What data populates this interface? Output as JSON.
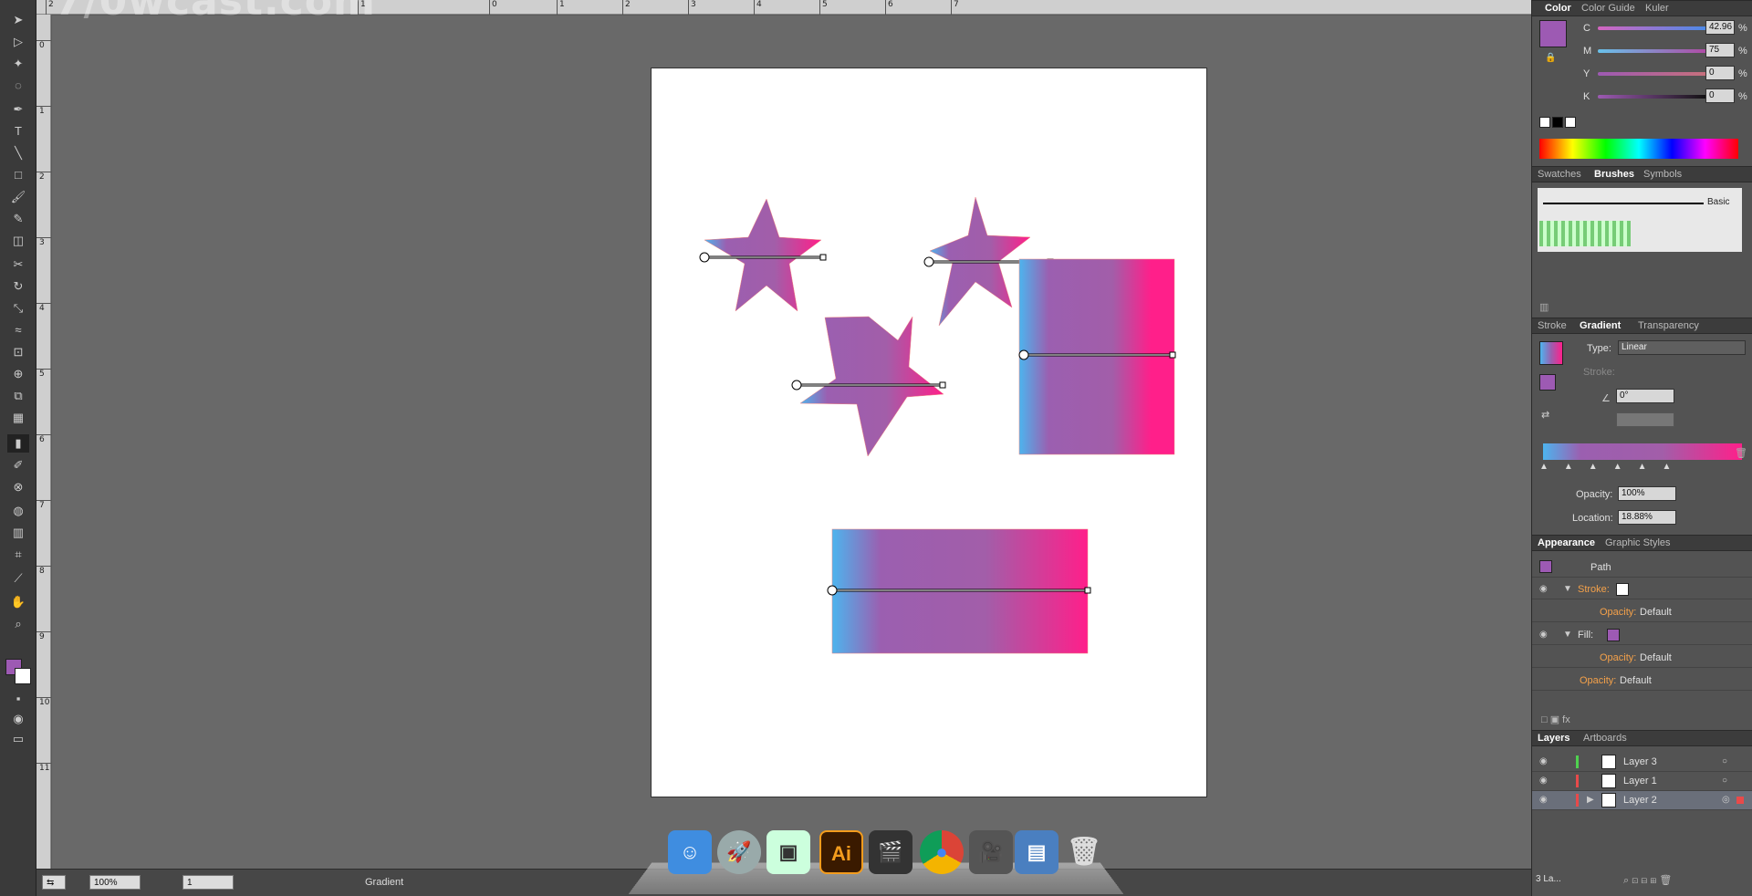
{
  "watermark": "7/0wcast.com",
  "ruler": {
    "top_ticks": [
      "2",
      "1",
      "0",
      "1",
      "2",
      "3",
      "4",
      "5",
      "6",
      "7"
    ],
    "left_ticks": [
      "0",
      "1",
      "2",
      "3",
      "4",
      "5",
      "6",
      "7",
      "8",
      "9",
      "10",
      "11"
    ]
  },
  "color_panel": {
    "tabs": [
      "Color",
      "Color Guide",
      "Kuler"
    ],
    "channels": [
      {
        "label": "C",
        "value": "42.96",
        "unit": "%",
        "level": 0.43
      },
      {
        "label": "M",
        "value": "75",
        "unit": "%",
        "level": 0.75
      },
      {
        "label": "Y",
        "value": "0",
        "unit": "%",
        "level": 0.0
      },
      {
        "label": "K",
        "value": "0",
        "unit": "%",
        "level": 0.0
      }
    ],
    "fill_color": "#9d5ab3"
  },
  "brushes_panel": {
    "tabs": [
      "Swatches",
      "Brushes",
      "Symbols"
    ],
    "basic_label": "Basic"
  },
  "gradient_panel": {
    "tabs": [
      "Stroke",
      "Gradient",
      "Transparency"
    ],
    "type_label": "Type:",
    "type_value": "Linear",
    "stroke_label": "Stroke:",
    "angle_value": "0°",
    "opacity_label": "Opacity:",
    "opacity_value": "100%",
    "location_label": "Location:",
    "location_value": "18.88%",
    "start_color": "#4db4ee",
    "mid_color": "#9b5fb0",
    "end_color": "#ff1f8a"
  },
  "appearance_panel": {
    "tabs": [
      "Appearance",
      "Graphic Styles"
    ],
    "title": "Path",
    "stroke_label": "Stroke:",
    "opacity_label": "Opacity:",
    "opacity_value": "Default",
    "fill_label": "Fill:",
    "fill_opacity_label": "Opacity:",
    "fill_opacity_value": "Default",
    "path_opacity_label": "Opacity:",
    "path_opacity_value": "Default"
  },
  "layers_panel": {
    "tabs": [
      "Layers",
      "Artboards"
    ],
    "layers": [
      {
        "name": "Layer 3",
        "color": "#4fd14f"
      },
      {
        "name": "Layer 1",
        "color": "#e84a4a"
      },
      {
        "name": "Layer 2",
        "color": "#e84a4a"
      }
    ],
    "footer_label": "3 La..."
  },
  "statusbar": {
    "zoom": "100%",
    "artboard": "1",
    "tool_label": "Gradient"
  },
  "dock": {
    "apps": [
      "finder-icon",
      "launchpad-icon",
      "preview-icon",
      "illustrator-icon",
      "final-cut-icon",
      "chrome-icon",
      "imovie-icon",
      "keynote-icon",
      "trash-icon"
    ],
    "ai_label": "Ai"
  }
}
